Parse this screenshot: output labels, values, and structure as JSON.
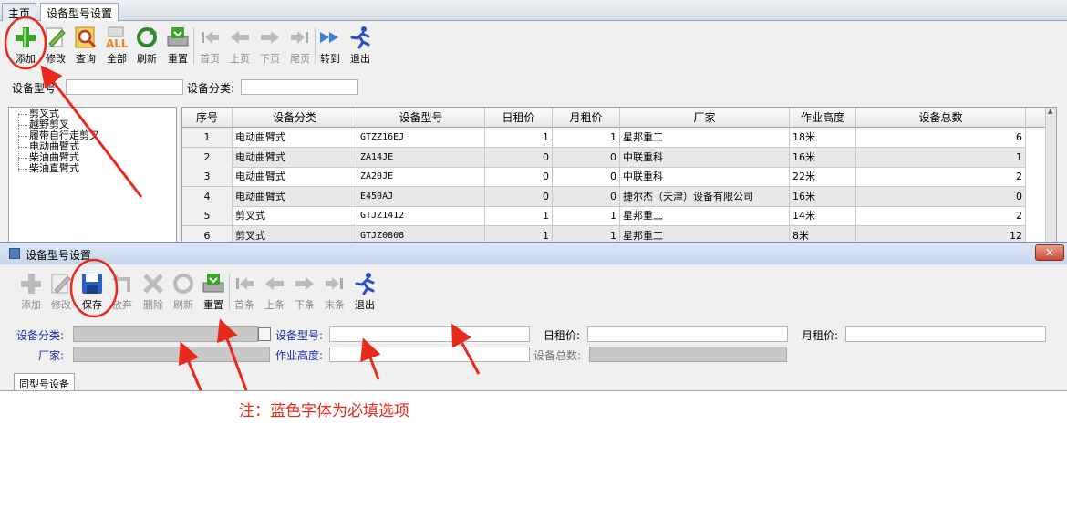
{
  "tabs": [
    {
      "label": "主页"
    },
    {
      "label": "设备型号设置"
    }
  ],
  "main_toolbar": [
    {
      "label": "添加",
      "icon": "plus-icon"
    },
    {
      "label": "修改",
      "icon": "edit-icon"
    },
    {
      "label": "查询",
      "icon": "search-icon"
    },
    {
      "label": "全部",
      "icon": "all-icon"
    },
    {
      "label": "刷新",
      "icon": "refresh-icon"
    },
    {
      "label": "重置",
      "icon": "reset-icon"
    },
    {
      "label": "首页",
      "icon": "first-page-icon"
    },
    {
      "label": "上页",
      "icon": "prev-page-icon"
    },
    {
      "label": "下页",
      "icon": "next-page-icon"
    },
    {
      "label": "尾页",
      "icon": "last-page-icon"
    },
    {
      "label": "转到",
      "icon": "goto-icon"
    },
    {
      "label": "退出",
      "icon": "exit-icon"
    }
  ],
  "search": {
    "model_label": "设备型号",
    "category_label": "设备分类:"
  },
  "tree_items": [
    "剪叉式",
    "越野剪叉",
    "履带自行走剪叉",
    "电动曲臂式",
    "柴油曲臂式",
    "柴油直臂式"
  ],
  "grid": {
    "columns": [
      "序号",
      "设备分类",
      "设备型号",
      "日租价",
      "月租价",
      "厂家",
      "作业高度",
      "设备总数"
    ],
    "rows": [
      [
        "1",
        "电动曲臂式",
        "GTZZ16EJ",
        "1",
        "1",
        "星邦重工",
        "18米",
        "6"
      ],
      [
        "2",
        "电动曲臂式",
        "ZA14JE",
        "0",
        "0",
        "中联重科",
        "16米",
        "1"
      ],
      [
        "3",
        "电动曲臂式",
        "ZA20JE",
        "0",
        "0",
        "中联重科",
        "22米",
        "2"
      ],
      [
        "4",
        "电动曲臂式",
        "E450AJ",
        "0",
        "0",
        "捷尔杰（天津）设备有限公司",
        "16米",
        "0"
      ],
      [
        "5",
        "剪叉式",
        "GTJZ1412",
        "1",
        "1",
        "星邦重工",
        "14米",
        "2"
      ],
      [
        "6",
        "剪叉式",
        "GTJZ0808",
        "1",
        "1",
        "星邦重工",
        "8米",
        "12"
      ]
    ]
  },
  "dialog": {
    "title": "设备型号设置",
    "close_label": "✕",
    "toolbar": [
      {
        "label": "添加",
        "icon": "plus-icon",
        "enabled": false
      },
      {
        "label": "修改",
        "icon": "edit-icon",
        "enabled": false
      },
      {
        "label": "保存",
        "icon": "save-icon",
        "enabled": true
      },
      {
        "label": "放弃",
        "icon": "undo-icon",
        "enabled": false
      },
      {
        "label": "删除",
        "icon": "delete-icon",
        "enabled": false
      },
      {
        "label": "刷新",
        "icon": "refresh-icon",
        "enabled": false
      },
      {
        "label": "重置",
        "icon": "reset-icon",
        "enabled": true
      },
      {
        "label": "首条",
        "icon": "first-record-icon",
        "enabled": false
      },
      {
        "label": "上条",
        "icon": "prev-record-icon",
        "enabled": false
      },
      {
        "label": "下条",
        "icon": "next-record-icon",
        "enabled": false
      },
      {
        "label": "末条",
        "icon": "last-record-icon",
        "enabled": false
      },
      {
        "label": "退出",
        "icon": "exit-icon",
        "enabled": true
      }
    ],
    "fields": {
      "category_label": "设备分类:",
      "model_label": "设备型号:",
      "daily_label": "日租价:",
      "monthly_label": "月租价:",
      "maker_label": "厂家:",
      "height_label": "作业高度:",
      "total_label": "设备总数:"
    },
    "bottom_tab": "同型号设备"
  },
  "note": "注：蓝色字体为必填选项",
  "colors": {
    "required_label": "#1b2fae",
    "annotation": "#e8291c"
  }
}
